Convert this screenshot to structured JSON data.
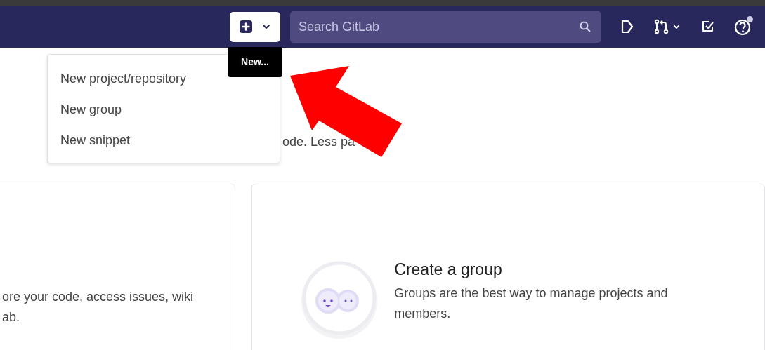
{
  "navbar": {
    "new_button": {
      "tooltip": "New..."
    },
    "search": {
      "placeholder": "Search GitLab"
    },
    "help": {
      "has_notification": true
    }
  },
  "new_menu": {
    "items": [
      {
        "label": "New project/repository"
      },
      {
        "label": "New group"
      },
      {
        "label": "New snippet"
      }
    ]
  },
  "intro": {
    "text": "ode. Less pa"
  },
  "cards": [
    {
      "kind": "text",
      "lines": [
        "ore your code, access issues, wiki",
        "ab."
      ]
    },
    {
      "kind": "group",
      "title": "Create a group",
      "lines": [
        "Groups are the best way to manage projects and",
        "members."
      ]
    }
  ]
}
